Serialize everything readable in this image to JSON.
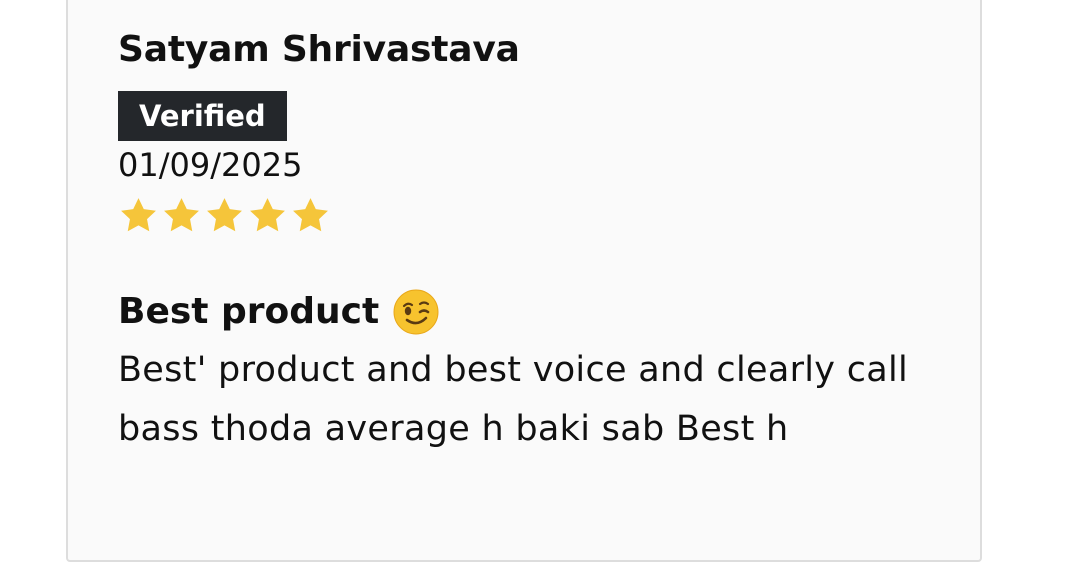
{
  "review": {
    "reviewer_name": "Satyam Shrivastava",
    "badge": "Verified",
    "date": "01/09/2025",
    "rating": 5,
    "rating_max": 5,
    "title": "Best product",
    "title_emoji": "wink-face-icon",
    "body": "Best' product and best voice and clearly call bass thoda average h baki sab Best h"
  },
  "colors": {
    "star": "#f5c53a",
    "badge_bg": "#24272b",
    "card_bg": "#fafafa",
    "card_border": "#dddddd"
  }
}
